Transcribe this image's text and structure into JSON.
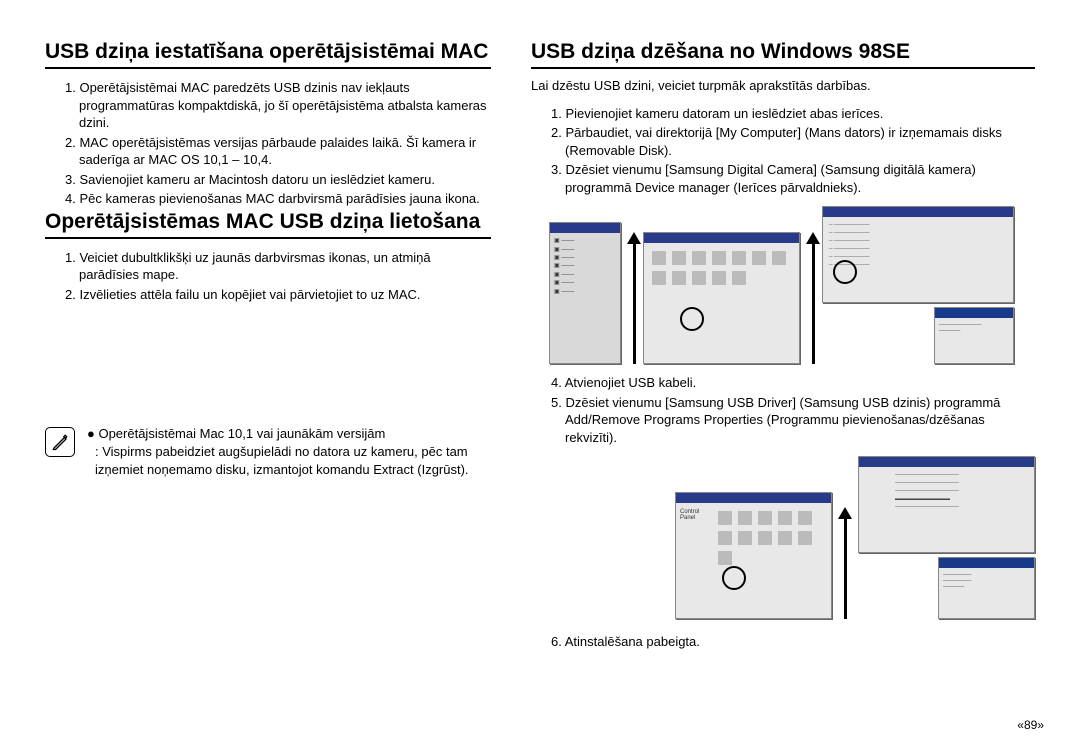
{
  "left": {
    "h1": "USB dziņa iestatīšana operētājsistēmai MAC",
    "s1_1": "1. Operētājsistēmai MAC paredzēts USB dzinis nav iekļauts programmatūras kompaktdiskā, jo šī operētājsistēma atbalsta kameras dzini.",
    "s1_2": "2. MAC operētājsistēmas versijas pārbaude palaides laikā. Šī kamera ir saderīga ar MAC OS 10,1 – 10,4.",
    "s1_3": "3. Savienojiet kameru ar Macintosh datoru un ieslēdziet kameru.",
    "s1_4": "4. Pēc kameras pievienošanas MAC darbvirsmā parādīsies jauna ikona.",
    "h2": "Operētājsistēmas MAC USB dziņa lietošana",
    "s2_1": "1. Veiciet dubultklikšķi uz jaunās darbvirsmas ikonas, un atmiņā parādīsies mape.",
    "s2_2": "2. Izvēlieties attēla failu un kopējiet vai pārvietojiet to uz MAC.",
    "note_b": "● Operētājsistēmai Mac 10,1 vai jaunākām versijām",
    "note_t": ": Vispirms pabeidziet augšupielādi no datora uz kameru, pēc tam izņemiet noņemamo disku, izmantojot komandu Extract (Izgrūst)."
  },
  "right": {
    "h1": "USB dziņa dzēšana no Windows 98SE",
    "intro": "Lai dzēstu USB dzini, veiciet turpmāk aprakstītās darbības.",
    "s1": "1. Pievienojiet kameru datoram un ieslēdziet abas ierīces.",
    "s2": "2. Pārbaudiet, vai direktorijā [My Computer] (Mans dators) ir izņemamais disks (Removable Disk).",
    "s3": "3. Dzēsiet vienumu [Samsung Digital Camera] (Samsung digitālā kamera) programmā Device manager (Ierīces pārvaldnieks).",
    "s4": "4. Atvienojiet USB kabeli.",
    "s5": "5. Dzēsiet vienumu [Samsung USB Driver] (Samsung USB dzinis) programmā Add/Remove Programs Properties (Programmu pievienošanas/dzēšanas rekvizīti).",
    "s6": "6. Atinstalēšana pabeigta."
  },
  "pagenum": "«89»"
}
